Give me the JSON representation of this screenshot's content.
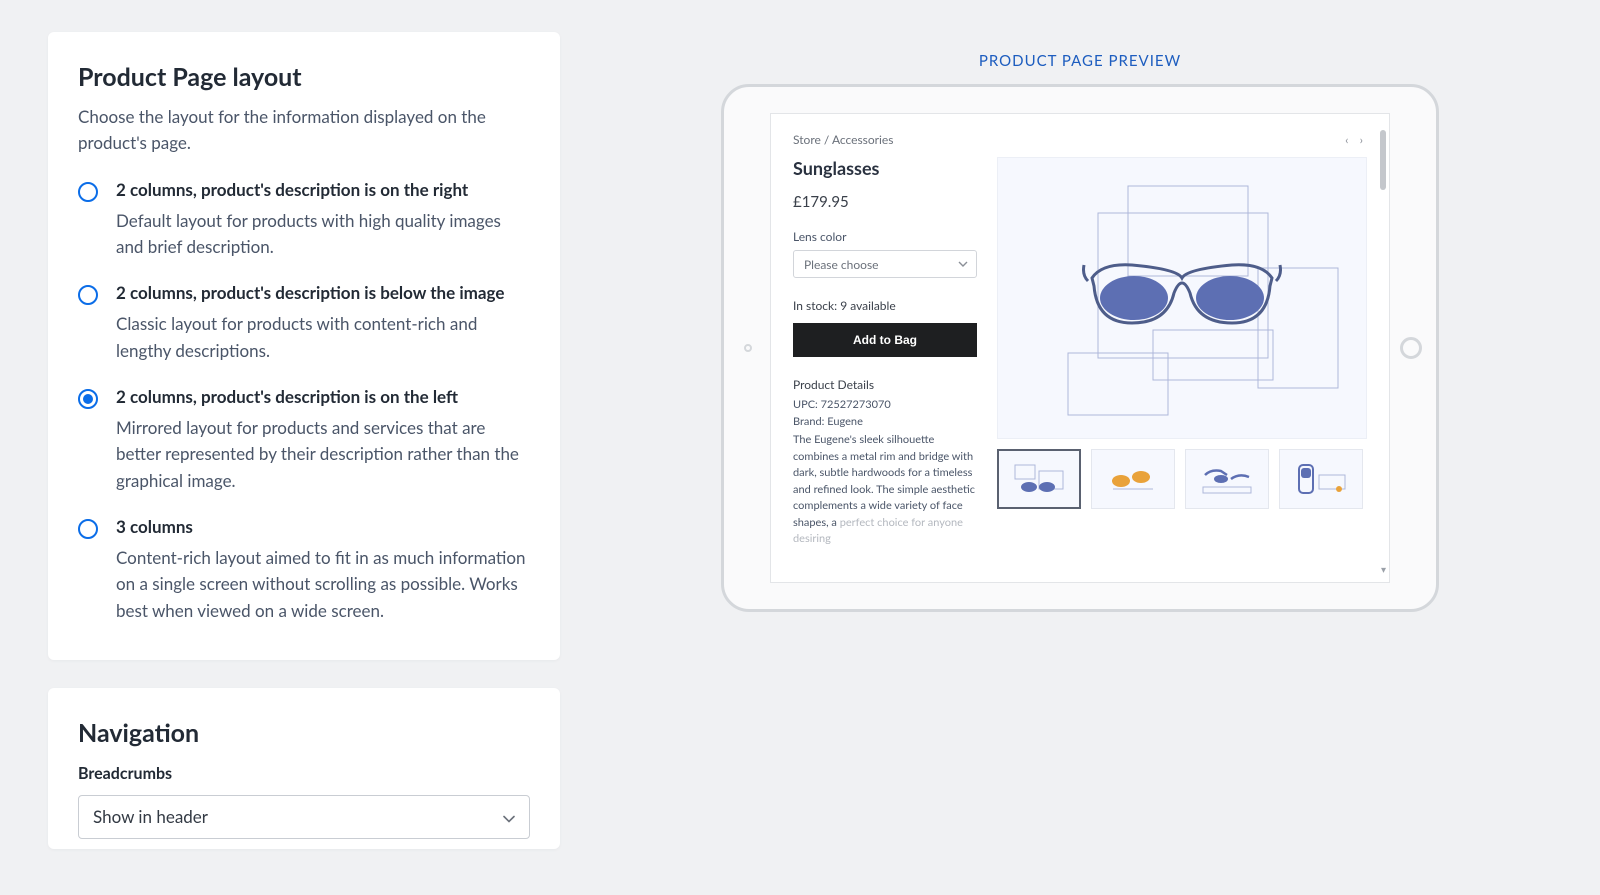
{
  "layout_card": {
    "title": "Product Page layout",
    "subtitle": "Choose the layout for the information displayed on the product's page.",
    "selected_index": 2,
    "options": [
      {
        "title": "2 columns, product's description is on the right",
        "desc": "Default layout for products with high quality images and brief description."
      },
      {
        "title": "2 columns, product's description is below the image",
        "desc": "Classic layout for products with content-rich and lengthy descriptions."
      },
      {
        "title": "2 columns, product's description is on the left",
        "desc": "Mirrored layout for products and services that are better represented by their description rather than the graphical image."
      },
      {
        "title": "3 columns",
        "desc": "Content-rich layout aimed to fit in as much information on a single screen without scrolling as possible. Works best when viewed on a wide screen."
      }
    ]
  },
  "nav_card": {
    "title": "Navigation",
    "breadcrumbs_label": "Breadcrumbs",
    "breadcrumbs_value": "Show in header"
  },
  "preview": {
    "title": "PRODUCT PAGE PREVIEW",
    "breadcrumb": "Store  /  Accessories",
    "nav_prev": "‹",
    "nav_next": "›",
    "product_name": "Sunglasses",
    "price": "£179.95",
    "lens_label": "Lens color",
    "lens_placeholder": "Please choose",
    "stock": "In stock: 9 available",
    "add_btn": "Add to Bag",
    "details_header": "Product Details",
    "upc": "UPC: 72527273070",
    "brand": "Brand: Eugene",
    "description_visible": "The Eugene's sleek silhouette combines a metal rim and bridge with dark, subtle hardwoods for a timeless and refined look. The simple aesthetic complements a wide variety of face shapes, a ",
    "description_fade": "perfect choice for anyone desiring"
  }
}
